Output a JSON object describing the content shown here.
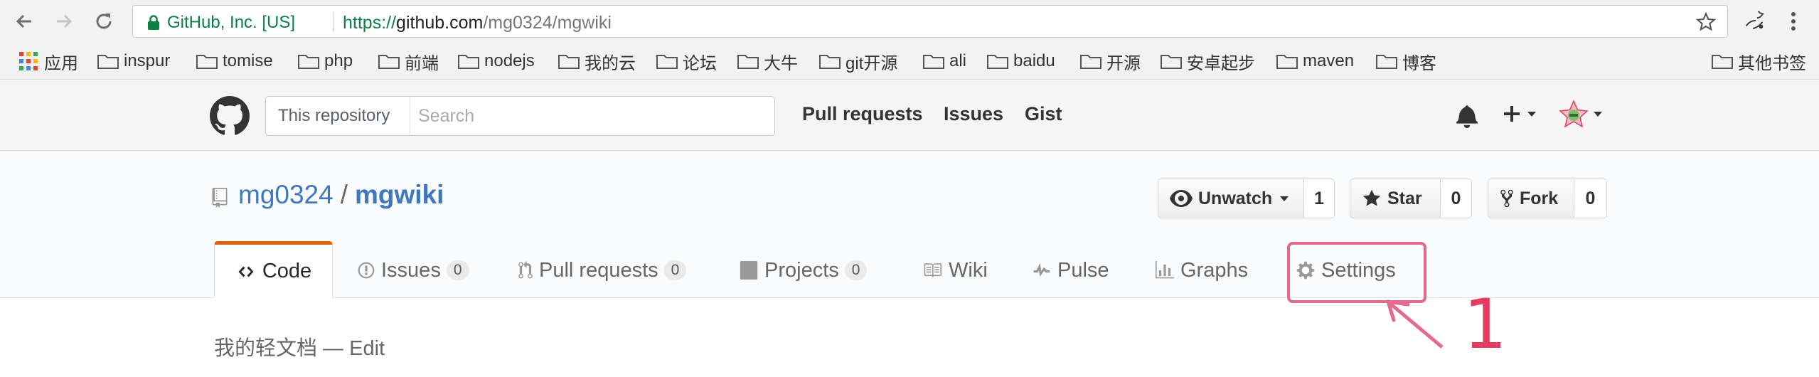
{
  "browser": {
    "ev_label": "GitHub, Inc. [US]",
    "url_scheme": "https://",
    "url_host": "github.com",
    "url_path": "/mg0324/mgwiki",
    "bookmarks": [
      {
        "label": "应用",
        "icon": "apps-grid-icon"
      },
      {
        "label": "inspur"
      },
      {
        "label": "tomise"
      },
      {
        "label": "php"
      },
      {
        "label": "前端"
      },
      {
        "label": "nodejs"
      },
      {
        "label": "我的云"
      },
      {
        "label": "论坛"
      },
      {
        "label": "大牛"
      },
      {
        "label": "git开源"
      },
      {
        "label": "ali"
      },
      {
        "label": "baidu"
      },
      {
        "label": "开源"
      },
      {
        "label": "安卓起步"
      },
      {
        "label": "maven"
      },
      {
        "label": "博客"
      }
    ],
    "other_bookmarks": "其他书签"
  },
  "header": {
    "search_scope": "This repository",
    "search_placeholder": "Search",
    "links": [
      "Pull requests",
      "Issues",
      "Gist"
    ]
  },
  "repo": {
    "owner": "mg0324",
    "separator": "/",
    "name": "mgwiki",
    "unwatch_label": "Unwatch",
    "watch_count": "1",
    "star_label": "Star",
    "star_count": "0",
    "fork_label": "Fork",
    "fork_count": "0",
    "tabs": [
      {
        "label": "Code"
      },
      {
        "label": "Issues",
        "count": "0"
      },
      {
        "label": "Pull requests",
        "count": "0"
      },
      {
        "label": "Projects",
        "count": "0"
      },
      {
        "label": "Wiki"
      },
      {
        "label": "Pulse"
      },
      {
        "label": "Graphs"
      },
      {
        "label": "Settings"
      }
    ],
    "description": "我的轻文档 — Edit"
  },
  "annotation": {
    "number": "1",
    "color": "#e43b5e"
  }
}
